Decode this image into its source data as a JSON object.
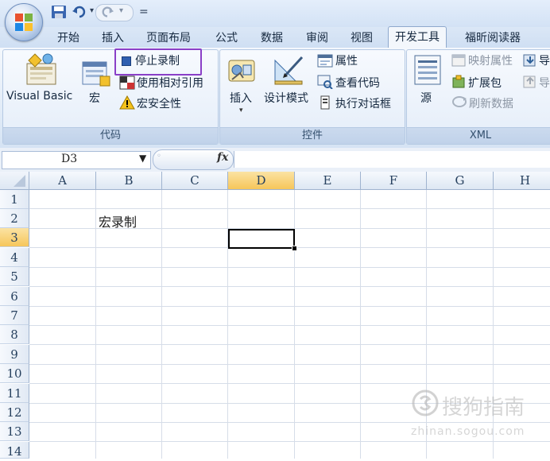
{
  "quick_access": {
    "separator": "="
  },
  "tabs": [
    "开始",
    "插入",
    "页面布局",
    "公式",
    "数据",
    "审阅",
    "视图",
    "开发工具",
    "福昕阅读器"
  ],
  "active_tab": "开发工具",
  "groups": {
    "code": {
      "label": "代码",
      "visual_basic": "Visual Basic",
      "macro": "宏",
      "stop_recording": "停止录制",
      "relative_ref": "使用相对引用",
      "macro_security": "宏安全性"
    },
    "controls": {
      "label": "控件",
      "insert": "插入",
      "design_mode": "设计模式",
      "properties": "属性",
      "view_code": "查看代码",
      "run_dialog": "执行对话框"
    },
    "xml": {
      "label": "XML",
      "source": "源",
      "map_properties": "映射属性",
      "expansion_packs": "扩展包",
      "refresh_data": "刷新数据",
      "import_partial": "导",
      "export_partial": "导"
    }
  },
  "formula_bar": {
    "name_box": "D3",
    "fx_label": "fx",
    "formula": ""
  },
  "columns": [
    "A",
    "B",
    "C",
    "D",
    "E",
    "F",
    "G",
    "H"
  ],
  "rows": [
    "1",
    "2",
    "3",
    "4",
    "5",
    "6",
    "7",
    "8",
    "9",
    "10",
    "11",
    "12",
    "13",
    "14"
  ],
  "selected_cell": {
    "column": "D",
    "row": "3"
  },
  "cells": {
    "B2": "宏录制"
  },
  "watermark": {
    "brand": "搜狗指南",
    "url": "zhinan.sogou.com"
  },
  "colors": {
    "highlight_box": "#8a3fc7",
    "ribbon_bg": "#dfeaf7",
    "selected_header": "#f6c65a"
  }
}
